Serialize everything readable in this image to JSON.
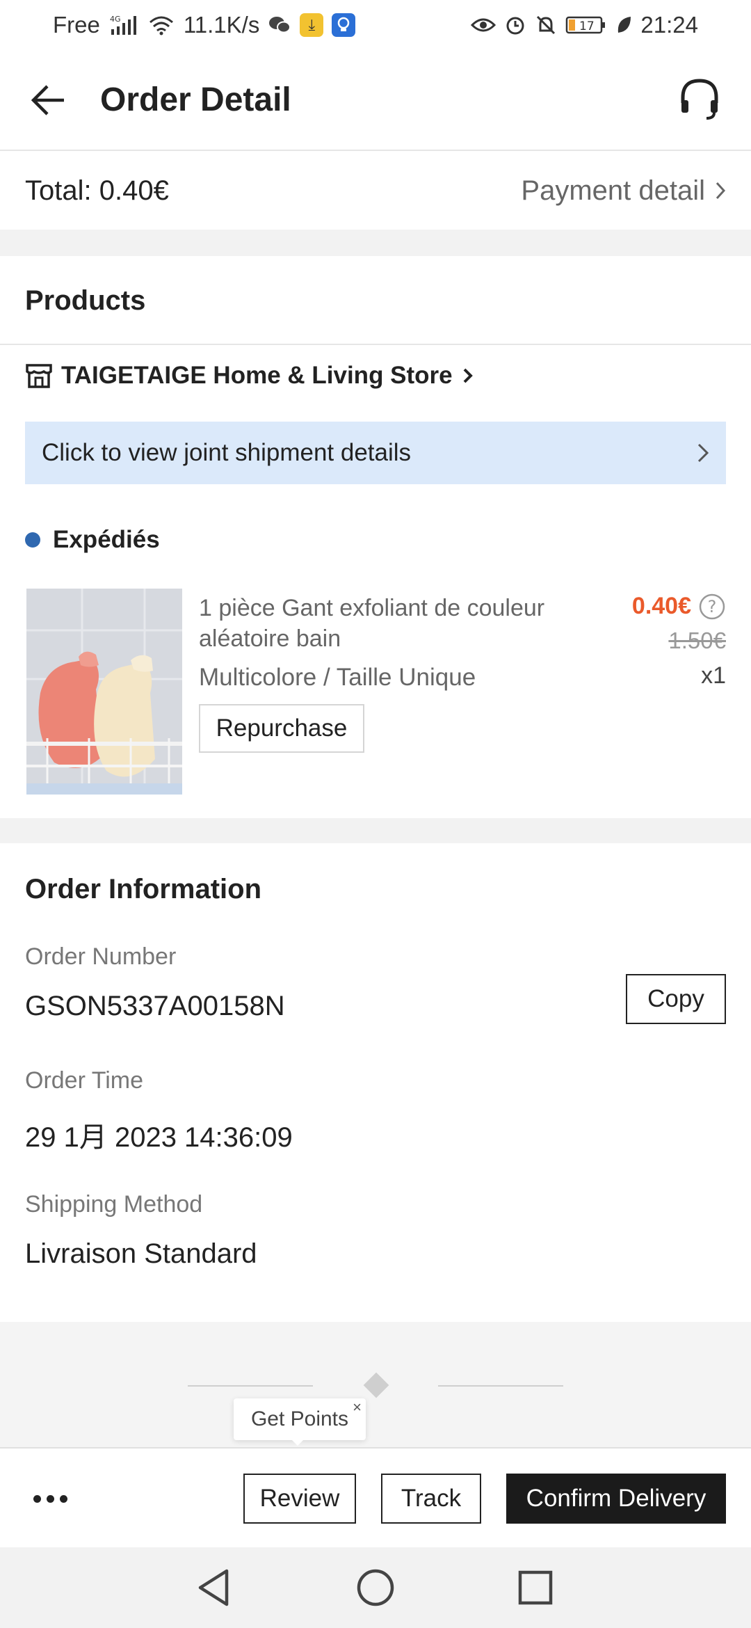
{
  "status_bar": {
    "carrier": "Free",
    "network": "4G",
    "speed": "11.1K/s",
    "battery": "17",
    "time": "21:24"
  },
  "header": {
    "title": "Order Detail"
  },
  "summary": {
    "total": "Total: 0.40€",
    "payment_detail": "Payment detail"
  },
  "products": {
    "section_title": "Products",
    "store_name": "TAIGETAIGE Home & Living Store",
    "joint_shipment": "Click to view joint shipment details",
    "status": "Expédiés",
    "status_color": "#2f68b0",
    "item": {
      "name": "1 pièce Gant exfoliant de couleur aléatoire bain",
      "variant": "Multicolore / Taille Unique",
      "price": "0.40€",
      "original_price": "1.50€",
      "quantity": "x1",
      "repurchase_label": "Repurchase"
    }
  },
  "order_info": {
    "section_title": "Order Information",
    "order_number_label": "Order Number",
    "order_number": "GSON5337A00158N",
    "copy_label": "Copy",
    "order_time_label": "Order Time",
    "order_time": "29 1月 2023 14:36:09",
    "shipping_label": "Shipping Method",
    "shipping_method": "Livraison Standard"
  },
  "tooltip": {
    "text": "Get Points",
    "close": "×"
  },
  "actions": {
    "review": "Review",
    "track": "Track",
    "confirm": "Confirm Delivery"
  },
  "colors": {
    "accent_price": "#ea5a2b",
    "banner_bg": "#dbe9fa",
    "primary_button": "#1b1b1b"
  }
}
